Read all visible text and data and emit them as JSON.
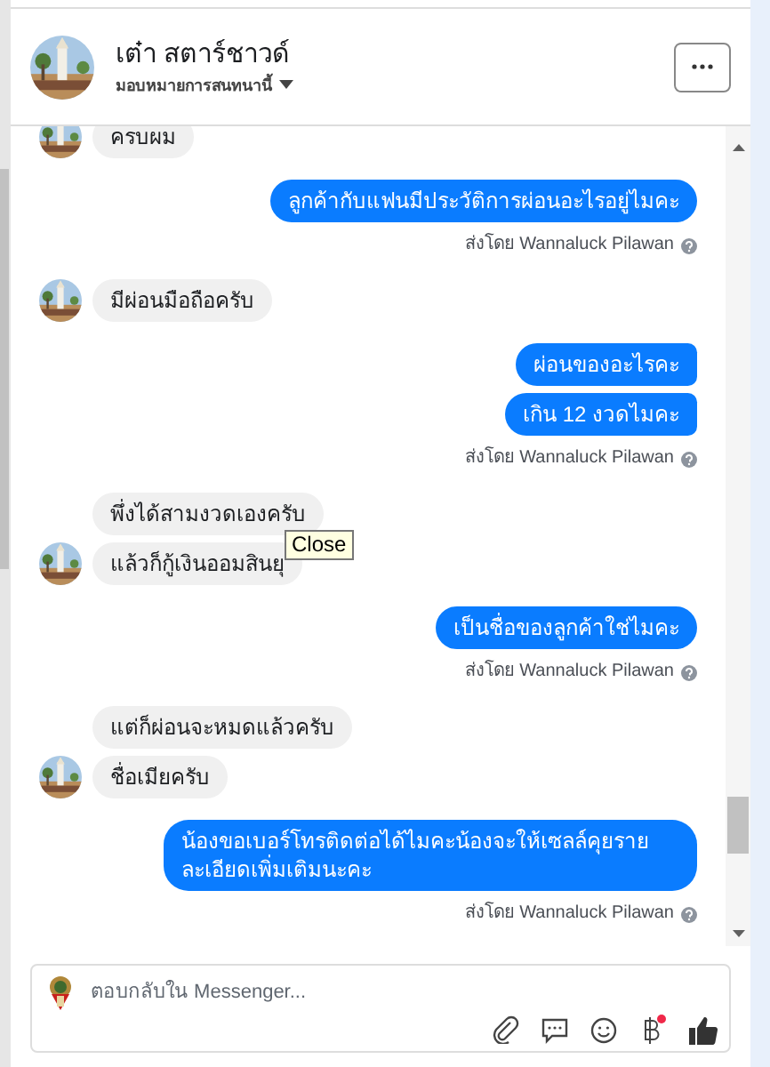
{
  "header": {
    "name": "เต๋า สตาร์ชาวด์",
    "subtitle": "มอบหมายการสนทนานี้"
  },
  "groups": [
    {
      "kind": "incoming",
      "messages": [
        "ครบผม"
      ]
    },
    {
      "kind": "outgoing",
      "messages": [
        "ลูกค้ากับแฟนมีประวัติการผ่อนอะไรอยู่ไมคะ"
      ],
      "sent_by": "ส่งโดย Wannaluck Pilawan"
    },
    {
      "kind": "incoming",
      "messages": [
        "มีผ่อนมือถือครับ"
      ]
    },
    {
      "kind": "outgoing",
      "messages": [
        "ผ่อนของอะไรคะ",
        "เกิน 12 งวดไมคะ"
      ],
      "sent_by": "ส่งโดย Wannaluck Pilawan"
    },
    {
      "kind": "incoming",
      "messages": [
        "พึ่งได้สามงวดเองครับ",
        "แล้วก็กู้เงินออมสินยุ"
      ]
    },
    {
      "kind": "outgoing",
      "messages": [
        "เป็นชื่อของลูกค้าใช่ไมคะ"
      ],
      "sent_by": "ส่งโดย Wannaluck Pilawan"
    },
    {
      "kind": "incoming",
      "messages": [
        "แต่ก็ผ่อนจะหมดแล้วครับ",
        "ชื่อเมียครับ"
      ]
    },
    {
      "kind": "outgoing",
      "messages": [
        "น้องขอเบอร์โทรติดต่อได้ไมคะน้องจะให้เซลล์คุยรายละเอียดเพิ่มเติมนะคะ"
      ],
      "sent_by": "ส่งโดย Wannaluck Pilawan"
    }
  ],
  "tooltip": "Close",
  "composer": {
    "placeholder": "ตอบกลับใน Messenger..."
  }
}
